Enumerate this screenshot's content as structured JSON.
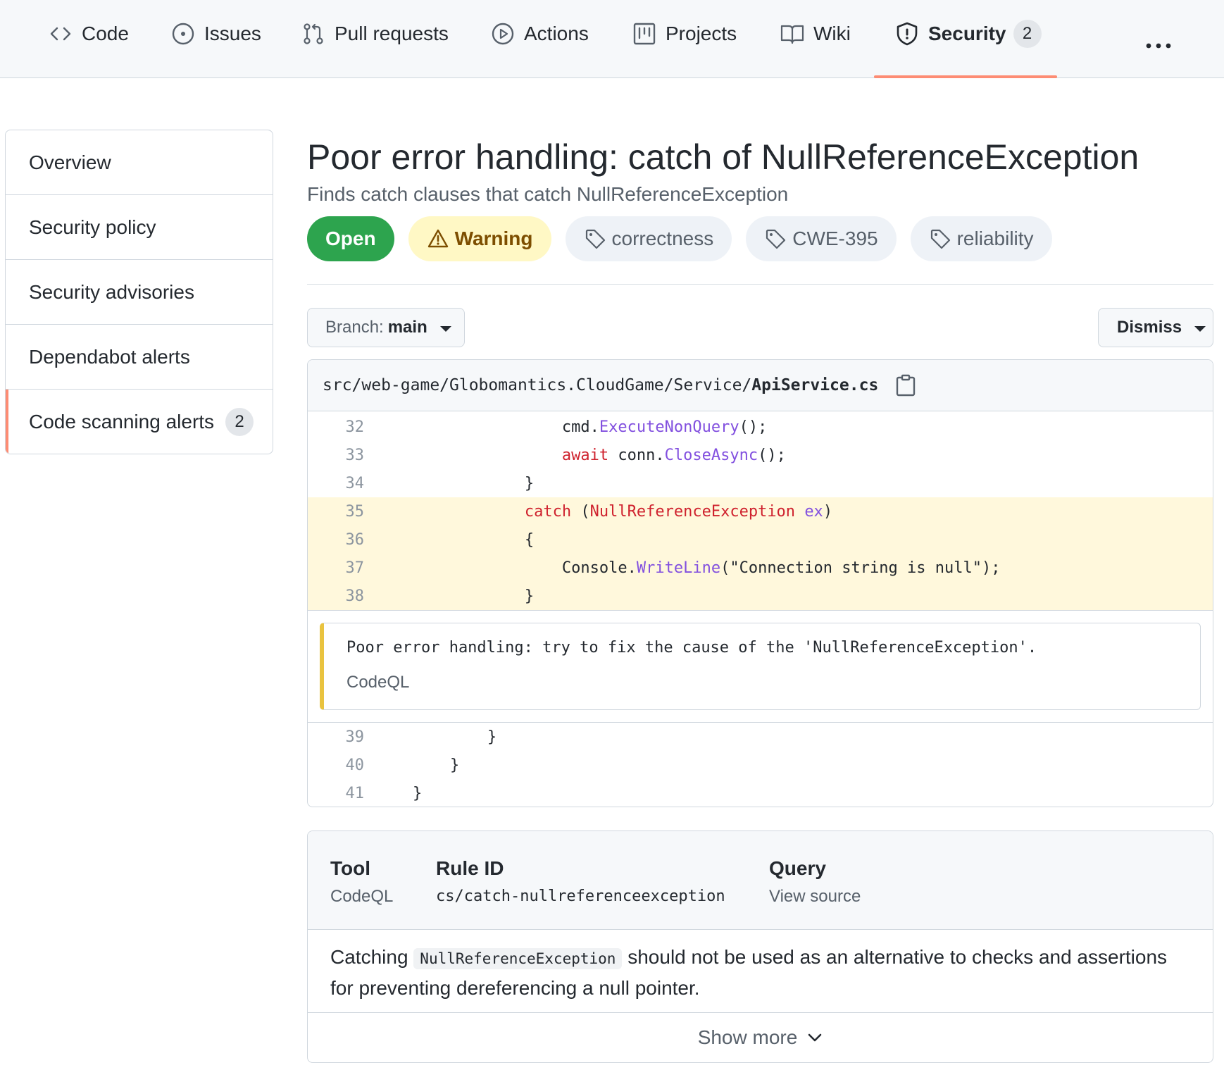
{
  "nav": {
    "tabs": [
      {
        "label": "Code",
        "icon": "code-icon"
      },
      {
        "label": "Issues",
        "icon": "issue-opened-icon"
      },
      {
        "label": "Pull requests",
        "icon": "git-pull-request-icon"
      },
      {
        "label": "Actions",
        "icon": "play-icon"
      },
      {
        "label": "Projects",
        "icon": "project-icon"
      },
      {
        "label": "Wiki",
        "icon": "book-icon"
      },
      {
        "label": "Security",
        "icon": "shield-icon",
        "counter": "2",
        "selected": true
      }
    ],
    "more_icon": "kebab-horizontal-icon",
    "accent_color": "#fd8c73"
  },
  "sidebar": {
    "items": [
      {
        "label": "Overview"
      },
      {
        "label": "Security policy"
      },
      {
        "label": "Security advisories"
      },
      {
        "label": "Dependabot alerts"
      },
      {
        "label": "Code scanning alerts",
        "counter": "2",
        "active": true
      }
    ]
  },
  "alert": {
    "title": "Poor error handling: catch of NullReferenceException",
    "subtitle": "Finds catch clauses that catch NullReferenceException",
    "status": "Open",
    "status_color": "#2da44e",
    "severity": "Warning",
    "severity_icon": "alert-icon",
    "tags": [
      "correctness",
      "CWE-395",
      "reliability"
    ],
    "tag_icon": "tag-icon"
  },
  "toolbar": {
    "branch_prefix": "Branch:",
    "branch_name": "main",
    "dismiss_label": "Dismiss"
  },
  "code": {
    "file_dir": "src/web-game/Globomantics.CloudGame/Service/",
    "file_name": "ApiService.cs",
    "copy_icon": "copy-icon",
    "lines_before": [
      {
        "num": "32",
        "tokens": [
          {
            "t": "                    "
          },
          {
            "t": "cmd."
          },
          {
            "t": "ExecuteNonQuery",
            "c": "fn"
          },
          {
            "t": "();"
          }
        ]
      },
      {
        "num": "33",
        "tokens": [
          {
            "t": "                    "
          },
          {
            "t": "await",
            "c": "kw"
          },
          {
            "t": " conn."
          },
          {
            "t": "CloseAsync",
            "c": "fn"
          },
          {
            "t": "();"
          }
        ]
      },
      {
        "num": "34",
        "tokens": [
          {
            "t": "                }"
          }
        ]
      }
    ],
    "lines_highlighted": [
      {
        "num": "35",
        "tokens": [
          {
            "t": "                "
          },
          {
            "t": "catch",
            "c": "kw"
          },
          {
            "t": " ("
          },
          {
            "t": "NullReferenceException",
            "c": "kw"
          },
          {
            "t": " "
          },
          {
            "t": "ex",
            "c": "fn"
          },
          {
            "t": ")"
          }
        ]
      },
      {
        "num": "36",
        "tokens": [
          {
            "t": "                {"
          }
        ]
      },
      {
        "num": "37",
        "tokens": [
          {
            "t": "                    "
          },
          {
            "t": "Console."
          },
          {
            "t": "WriteLine",
            "c": "fn"
          },
          {
            "t": "(\"Connection string is null\");"
          }
        ]
      },
      {
        "num": "38",
        "tokens": [
          {
            "t": "                }"
          }
        ]
      }
    ],
    "lines_after": [
      {
        "num": "39",
        "tokens": [
          {
            "t": "            }"
          }
        ]
      },
      {
        "num": "40",
        "tokens": [
          {
            "t": "        }"
          }
        ]
      },
      {
        "num": "41",
        "tokens": [
          {
            "t": "    }"
          }
        ]
      }
    ],
    "alert_message": "Poor error handling: try to fix the cause of the 'NullReferenceException'.",
    "alert_tool": "CodeQL",
    "highlight_color": "#fff8dc",
    "alert_border_color": "#e9c33f"
  },
  "rule": {
    "tool_header": "Tool",
    "tool_value": "CodeQL",
    "rule_id_header": "Rule ID",
    "rule_id_value": "cs/catch-nullreferenceexception",
    "query_header": "Query",
    "query_value": "View source",
    "desc_before": "Catching ",
    "desc_code": "NullReferenceException",
    "desc_after": " should not be used as an alternative to checks and assertions for preventing dereferencing a null pointer.",
    "show_more": "Show more"
  }
}
